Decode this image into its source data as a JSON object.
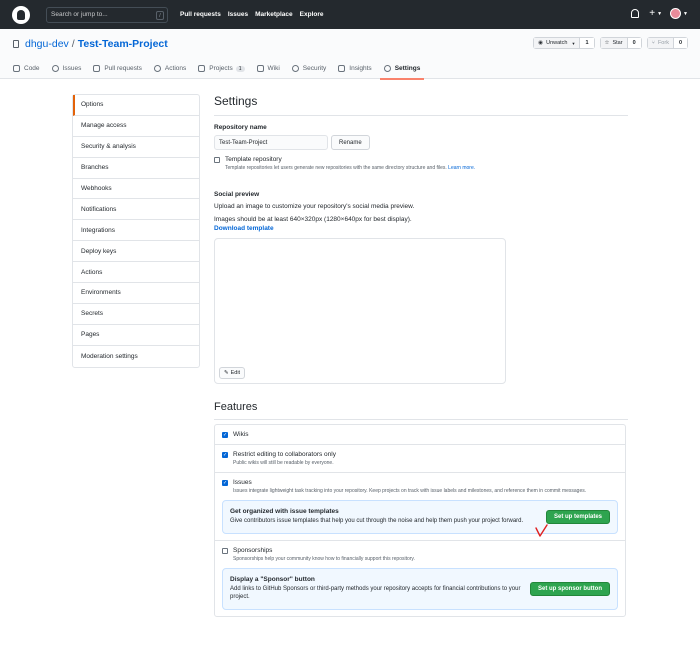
{
  "header": {
    "search_placeholder": "Search or jump to...",
    "search_key": "/",
    "nav": [
      "Pull requests",
      "Issues",
      "Marketplace",
      "Explore"
    ],
    "plus_label": "+"
  },
  "repo": {
    "owner": "dhgu-dev",
    "separator": "/",
    "name": "Test-Team-Project",
    "actions": {
      "watch_label": "Unwatch",
      "watch_count": "1",
      "star_label": "Star",
      "star_count": "0",
      "fork_label": "Fork",
      "fork_count": "0"
    },
    "tabs": [
      {
        "label": "Code"
      },
      {
        "label": "Issues"
      },
      {
        "label": "Pull requests"
      },
      {
        "label": "Actions"
      },
      {
        "label": "Projects",
        "badge": "1"
      },
      {
        "label": "Wiki"
      },
      {
        "label": "Security"
      },
      {
        "label": "Insights"
      },
      {
        "label": "Settings",
        "selected": true
      }
    ]
  },
  "sidebar": {
    "items": [
      "Options",
      "Manage access",
      "Security & analysis",
      "Branches",
      "Webhooks",
      "Notifications",
      "Integrations",
      "Deploy keys",
      "Actions",
      "Environments",
      "Secrets",
      "Pages",
      "Moderation settings"
    ]
  },
  "settings": {
    "title": "Settings",
    "repo_name_label": "Repository name",
    "repo_name_value": "Test-Team-Project",
    "rename_button": "Rename",
    "template_label": "Template repository",
    "template_note": "Template repositories let users generate new repositories with the same directory structure and files.",
    "template_learn_more": "Learn more.",
    "social_title": "Social preview",
    "social_text": "Upload an image to customize your repository's social media preview.",
    "social_size": "Images should be at least 640×320px (1280×640px for best display).",
    "download_template": "Download template",
    "edit_button": "Edit"
  },
  "features": {
    "title": "Features",
    "wikis_label": "Wikis",
    "restrict_label": "Restrict editing to collaborators only",
    "restrict_note": "Public wikis will still be readable by everyone.",
    "issues_label": "Issues",
    "issues_note": "Issues integrate lightweight task tracking into your repository. Keep projects on track with issue labels and milestones, and reference them in commit messages.",
    "issue_templates_title": "Get organized with issue templates",
    "issue_templates_text": "Give contributors issue templates that help you cut through the noise and help them push your project forward.",
    "issue_templates_button": "Set up templates",
    "sponsorships_label": "Sponsorships",
    "sponsorships_note": "Sponsorships help your community know how to financially support this repository.",
    "sponsor_title": "Display a \"Sponsor\" button",
    "sponsor_text": "Add links to GitHub Sponsors or third-party methods your repository accepts for financial contributions to your project.",
    "sponsor_button": "Set up sponsor button"
  },
  "colors": {
    "header_bg": "#24292e",
    "accent": "#f9826c",
    "link": "#0366d6",
    "green_button": "#2ea44f",
    "annotation": "#e02020"
  }
}
